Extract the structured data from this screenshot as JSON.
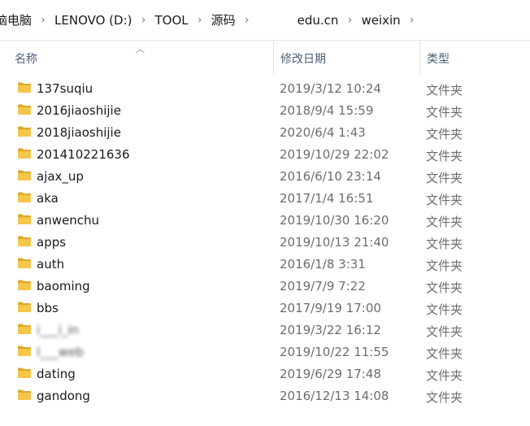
{
  "breadcrumb": {
    "items": [
      "脑电脑",
      "LENOVO (D:)",
      "TOOL",
      "源码",
      "edu.cn",
      "weixin"
    ],
    "separator": "›"
  },
  "columns": {
    "name": "名称",
    "date": "修改日期",
    "type": "类型"
  },
  "files": [
    {
      "name": "137suqiu",
      "date": "2019/3/12 10:24",
      "type": "文件夹"
    },
    {
      "name": "2016jiaoshijie",
      "date": "2018/9/4 15:59",
      "type": "文件夹"
    },
    {
      "name": "2018jiaoshijie",
      "date": "2020/6/4 1:43",
      "type": "文件夹"
    },
    {
      "name": "201410221636",
      "date": "2019/10/29 22:02",
      "type": "文件夹"
    },
    {
      "name": "ajax_up",
      "date": "2016/6/10 23:14",
      "type": "文件夹"
    },
    {
      "name": "aka",
      "date": "2017/1/4 16:51",
      "type": "文件夹"
    },
    {
      "name": "anwenchu",
      "date": "2019/10/30 16:20",
      "type": "文件夹"
    },
    {
      "name": "apps",
      "date": "2019/10/13 21:40",
      "type": "文件夹"
    },
    {
      "name": "auth",
      "date": "2016/1/8 3:31",
      "type": "文件夹"
    },
    {
      "name": "baoming",
      "date": "2019/7/9 7:22",
      "type": "文件夹"
    },
    {
      "name": "bbs",
      "date": "2017/9/19 17:00",
      "type": "文件夹"
    },
    {
      "name": "i___i_in",
      "date": "2019/3/22 16:12",
      "type": "文件夹",
      "redacted": true
    },
    {
      "name": "I___web",
      "date": "2019/10/22 11:55",
      "type": "文件夹",
      "redacted": true
    },
    {
      "name": "dating",
      "date": "2019/6/29 17:48",
      "type": "文件夹"
    },
    {
      "name": "gandong",
      "date": "2016/12/13 14:08",
      "type": "文件夹"
    }
  ],
  "colors": {
    "folder": "#f4c64a",
    "folder_tab": "#dca92b"
  }
}
